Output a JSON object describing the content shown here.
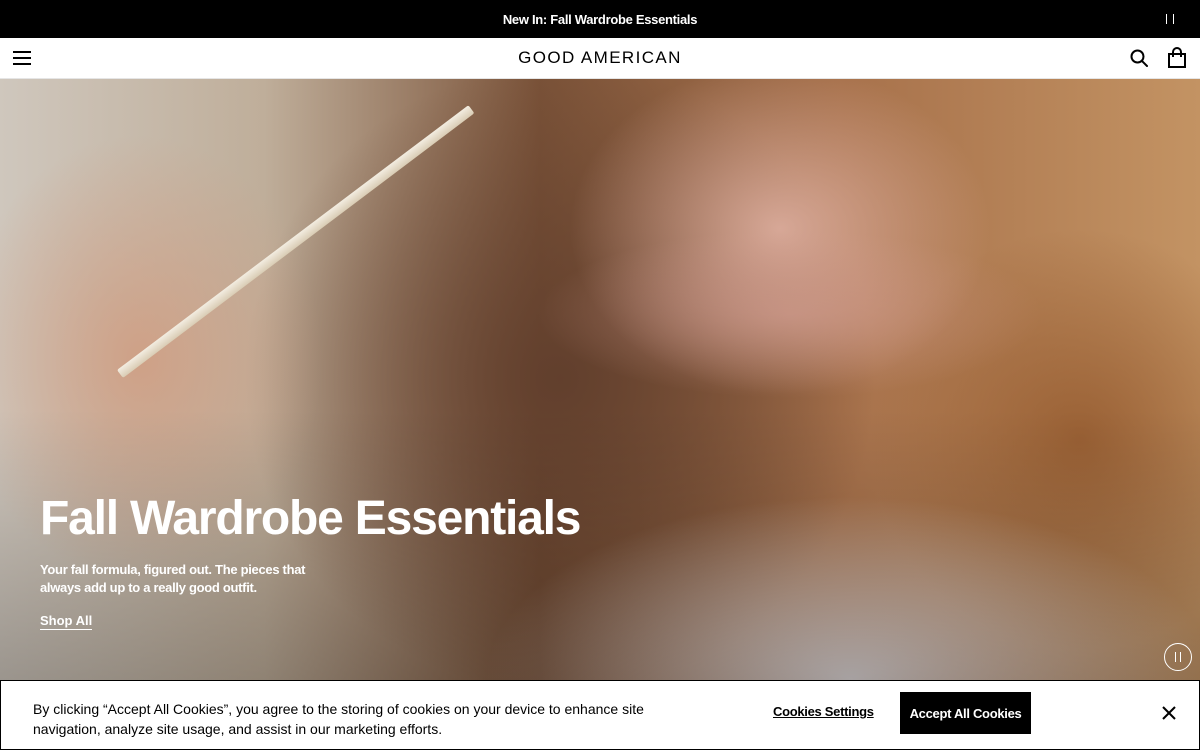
{
  "announcement": {
    "text": "New In: Fall Wardrobe Essentials",
    "pause_icon": "pause-icon"
  },
  "header": {
    "menu_icon": "hamburger-menu-icon",
    "logo": "GOOD AMERICAN",
    "search_icon": "search-icon",
    "bag_icon": "shopping-bag-icon"
  },
  "hero": {
    "title": "Fall Wardrobe Essentials",
    "subtitle": "Your fall formula, figured out. The pieces that always add up to a really good outfit.",
    "link_label": "Shop All",
    "pause_icon": "pause-icon"
  },
  "cookie_banner": {
    "text": "By clicking “Accept All Cookies”, you agree to the storing of cookies on your device to enhance site navigation, analyze site usage, and assist in our marketing efforts.",
    "settings_label": "Cookies Settings",
    "accept_label": "Accept All Cookies",
    "close_icon": "close-icon"
  }
}
